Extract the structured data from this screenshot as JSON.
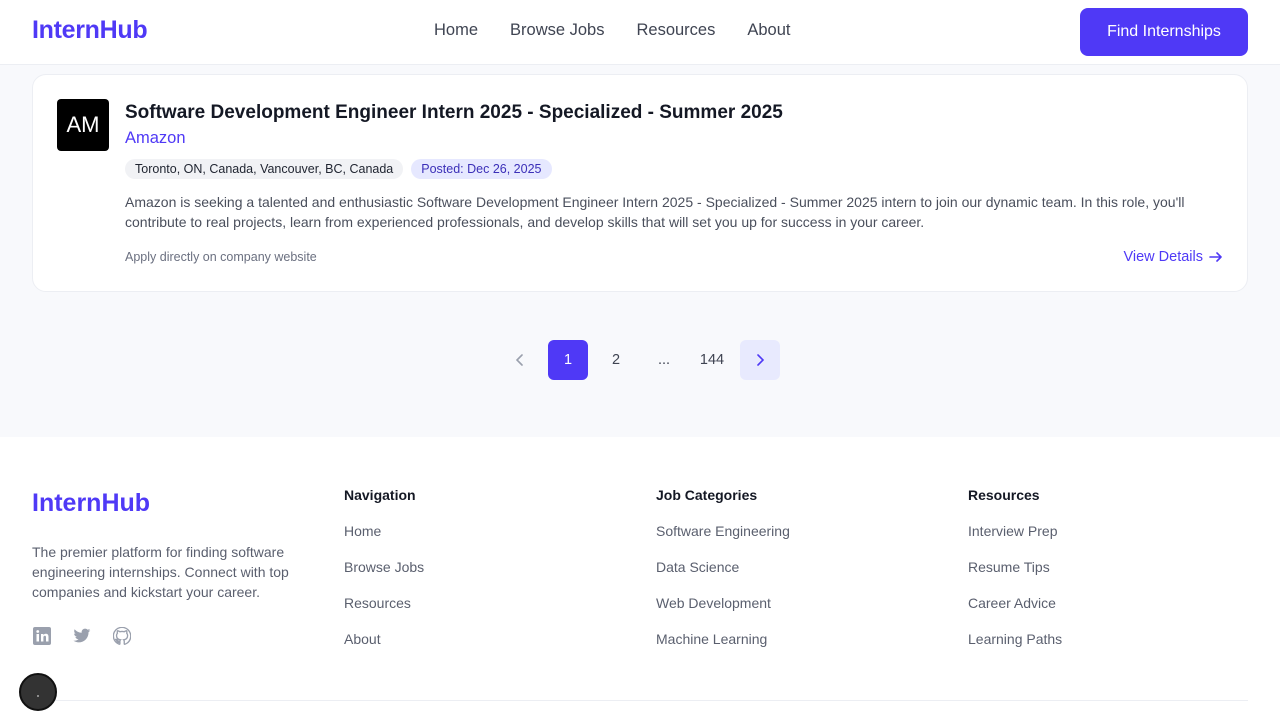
{
  "header": {
    "logo": "InternHub",
    "nav": [
      "Home",
      "Browse Jobs",
      "Resources",
      "About"
    ],
    "cta_label": "Find Internships"
  },
  "job": {
    "logo_text": "AM",
    "title": "Software Development Engineer Intern 2025 - Specialized - Summer 2025",
    "company": "Amazon",
    "location": "Toronto, ON, Canada, Vancouver, BC, Canada",
    "posted": "Posted: Dec 26, 2025",
    "description": "Amazon is seeking a talented and enthusiastic Software Development Engineer Intern 2025 - Specialized - Summer 2025 intern to join our dynamic team. In this role, you'll contribute to real projects, learn from experienced professionals, and develop skills that will set you up for success in your career.",
    "apply_note": "Apply directly on company website",
    "view_details_label": "View Details"
  },
  "pagination": {
    "current": "1",
    "next_page": "2",
    "ellipsis": "...",
    "last_page": "144"
  },
  "footer": {
    "logo": "InternHub",
    "description": "The premier platform for finding software engineering internships. Connect with top companies and kickstart your career.",
    "socials": [
      "linkedin-icon",
      "twitter-icon",
      "github-icon"
    ],
    "columns": [
      {
        "title": "Navigation",
        "links": [
          "Home",
          "Browse Jobs",
          "Resources",
          "About"
        ]
      },
      {
        "title": "Job Categories",
        "links": [
          "Software Engineering",
          "Data Science",
          "Web Development",
          "Machine Learning"
        ]
      },
      {
        "title": "Resources",
        "links": [
          "Interview Prep",
          "Resume Tips",
          "Career Advice",
          "Learning Paths"
        ]
      }
    ]
  },
  "colors": {
    "accent": "#4f39f6",
    "page_bg": "#f8f9fc",
    "tag_date_bg": "#e6e8ff"
  }
}
